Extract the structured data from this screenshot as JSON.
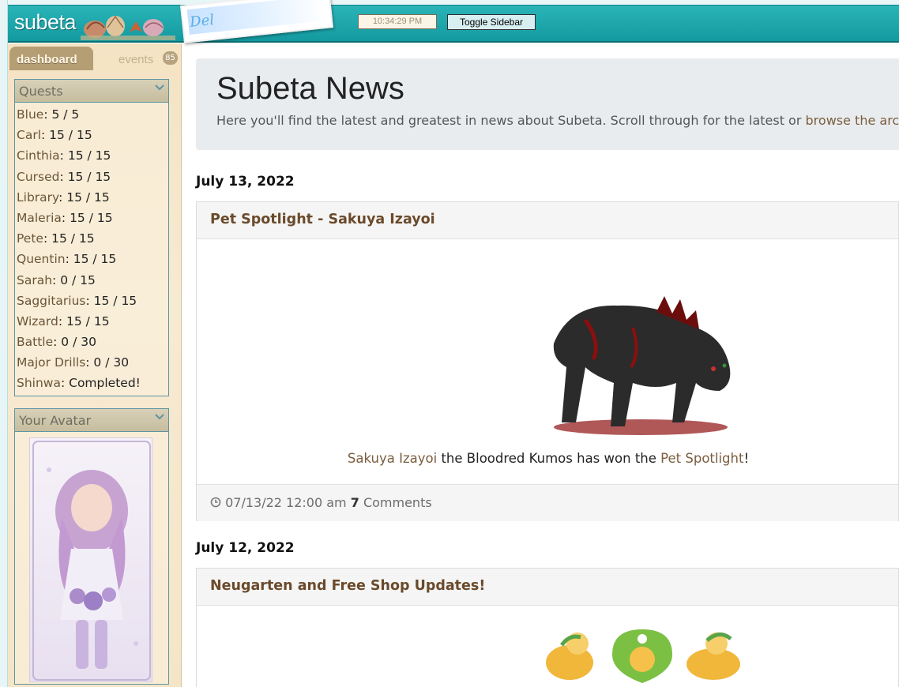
{
  "header": {
    "logo_text": "subeta",
    "photo_text": "Del",
    "clock": "10:34:29 PM",
    "toggle_label": "Toggle Sidebar"
  },
  "sidebar": {
    "tabs": {
      "dashboard": "dashboard",
      "events": "events",
      "events_count": "85"
    },
    "quests_title": "Quests",
    "quests": [
      {
        "name": "Blue",
        "value": "5 / 5"
      },
      {
        "name": "Carl",
        "value": "15 / 15"
      },
      {
        "name": "Cinthia",
        "value": "15 / 15"
      },
      {
        "name": "Cursed",
        "value": "15 / 15"
      },
      {
        "name": "Library",
        "value": "15 / 15"
      },
      {
        "name": "Maleria",
        "value": "15 / 15"
      },
      {
        "name": "Pete",
        "value": "15 / 15"
      },
      {
        "name": "Quentin",
        "value": "15 / 15"
      },
      {
        "name": "Sarah",
        "value": "0 / 15"
      },
      {
        "name": "Saggitarius",
        "value": "15 / 15"
      },
      {
        "name": "Wizard",
        "value": "15 / 15"
      },
      {
        "name": "Battle",
        "value": "0 / 30"
      },
      {
        "name": "Major Drills",
        "value": "0 / 30"
      },
      {
        "name": "Shinwa",
        "value": "Completed!"
      }
    ],
    "avatar_title": "Your Avatar"
  },
  "main": {
    "title": "Subeta News",
    "intro_prefix": "Here you'll find the latest and greatest in news about Subeta. Scroll through for the latest or ",
    "intro_link": "browse the archive",
    "posts": [
      {
        "date": "July 13, 2022",
        "title": "Pet Spotlight - Sakuya Izayoi",
        "pet_name": "Sakuya Izayoi",
        "text_middle": " the Bloodred Kumos has won the ",
        "spotlight_link": "Pet Spotlight",
        "text_end": "!",
        "timestamp": "07/13/22 12:00 am",
        "comment_count": "7",
        "comments_label": "Comments"
      },
      {
        "date": "July 12, 2022",
        "title": "Neugarten and Free Shop Updates!"
      }
    ]
  },
  "colors": {
    "header_teal": "#1aa5aa",
    "sidebar_bg": "#f5e5c7",
    "link_brown": "#7a5e3e",
    "panel_border": "#5f94a2"
  },
  "icons": [
    "chevron-down-icon",
    "clock-icon"
  ]
}
